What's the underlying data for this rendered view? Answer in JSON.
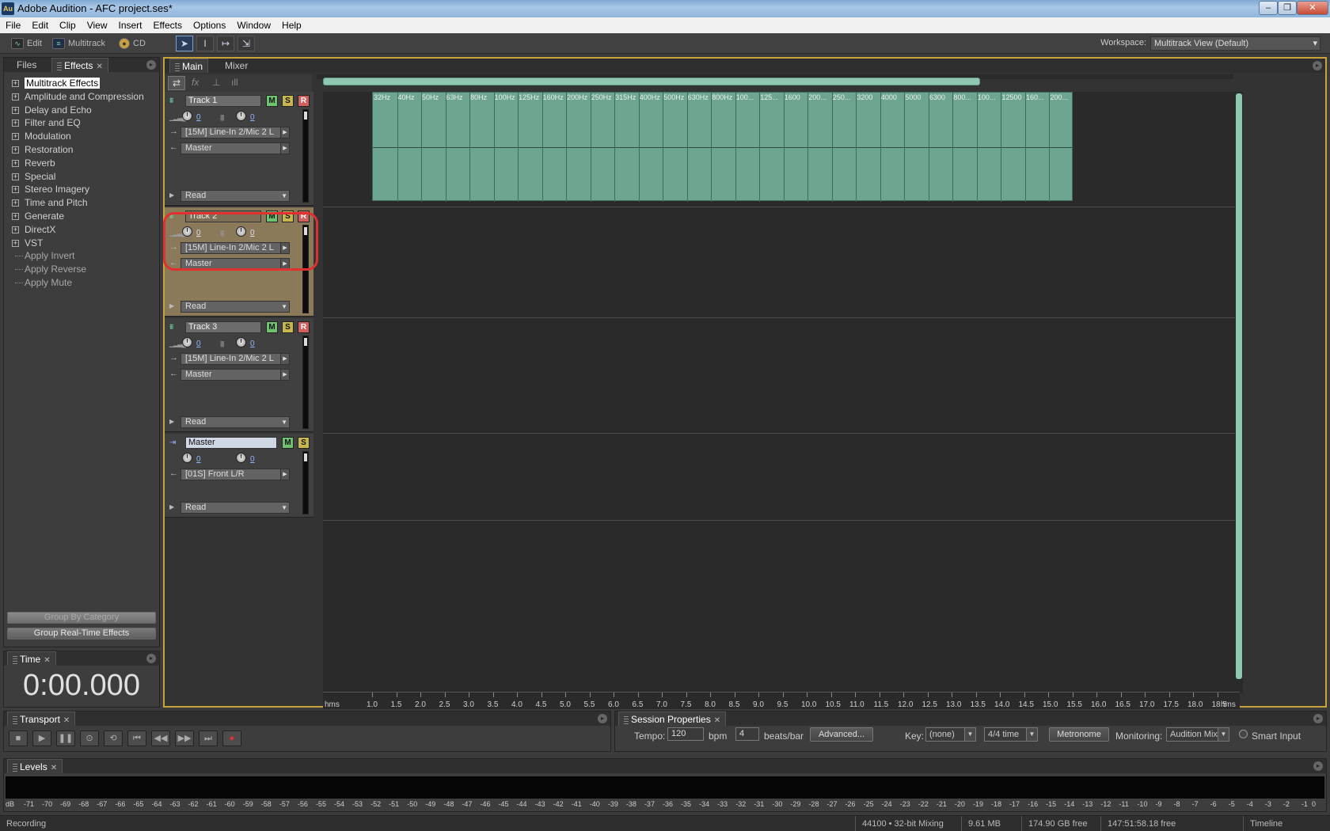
{
  "window": {
    "title": "Adobe Audition - AFC project.ses*",
    "app_icon": "Au"
  },
  "menu": [
    "File",
    "Edit",
    "Clip",
    "View",
    "Insert",
    "Effects",
    "Options",
    "Window",
    "Help"
  ],
  "toolbar": {
    "edit": "Edit",
    "multitrack": "Multitrack",
    "cd": "CD",
    "workspace_label": "Workspace:",
    "workspace_value": "Multitrack View (Default)"
  },
  "left_panel": {
    "tabs": [
      "Files",
      "Effects"
    ],
    "tree": [
      {
        "label": "Multitrack Effects",
        "expand": "+",
        "selected": true
      },
      {
        "label": "Amplitude and Compression",
        "expand": "+"
      },
      {
        "label": "Delay and Echo",
        "expand": "+"
      },
      {
        "label": "Filter and EQ",
        "expand": "+"
      },
      {
        "label": "Modulation",
        "expand": "+"
      },
      {
        "label": "Restoration",
        "expand": "+"
      },
      {
        "label": "Reverb",
        "expand": "+"
      },
      {
        "label": "Special",
        "expand": "+"
      },
      {
        "label": "Stereo Imagery",
        "expand": "+"
      },
      {
        "label": "Time and Pitch",
        "expand": "+"
      },
      {
        "label": "Generate",
        "expand": "+"
      },
      {
        "label": "DirectX",
        "expand": "+"
      },
      {
        "label": "VST",
        "expand": "+"
      },
      {
        "label": "Apply Invert",
        "leaf": true
      },
      {
        "label": "Apply Reverse",
        "leaf": true
      },
      {
        "label": "Apply Mute",
        "leaf": true
      }
    ],
    "group_by_category": "Group By Category",
    "group_realtime": "Group Real-Time Effects"
  },
  "time_panel": {
    "tab": "Time",
    "value": "0:00.000"
  },
  "main_tabs": [
    "Main",
    "Mixer"
  ],
  "tracks": [
    {
      "name": "Track 1",
      "m": "M",
      "s": "S",
      "r": "R",
      "vol": "0",
      "pan": "0",
      "input": "[15M] Line-In 2/Mic 2 L",
      "output": "Master",
      "automation": "Read",
      "selected": false
    },
    {
      "name": "Track 2",
      "m": "M",
      "s": "S",
      "r": "R",
      "vol": "0",
      "pan": "0",
      "input": "[15M] Line-In 2/Mic 2 L",
      "output": "Master",
      "automation": "Read",
      "selected": true
    },
    {
      "name": "Track 3",
      "m": "M",
      "s": "S",
      "r": "R",
      "vol": "0",
      "pan": "0",
      "input": "[15M] Line-In 2/Mic 2 L",
      "output": "Master",
      "automation": "Read",
      "selected": false
    }
  ],
  "master": {
    "name": "Master",
    "m": "M",
    "s": "S",
    "vol": "0",
    "pan": "0",
    "output": "[01S] Front L/R",
    "automation": "Read"
  },
  "clip_labels": [
    "32Hz",
    "40Hz",
    "50Hz",
    "63Hz",
    "80Hz",
    "100Hz",
    "125Hz",
    "160Hz",
    "200Hz",
    "250Hz",
    "315Hz",
    "400Hz",
    "500Hz",
    "630Hz",
    "800Hz",
    "100...",
    "125...",
    "1600",
    "200...",
    "250...",
    "3200",
    "4000",
    "5000",
    "6300",
    "800...",
    "100...",
    "12500",
    "160...",
    "200..."
  ],
  "ruler": {
    "unit": "hms",
    "ticks": [
      "1.0",
      "1.5",
      "2.0",
      "2.5",
      "3.0",
      "3.5",
      "4.0",
      "4.5",
      "5.0",
      "5.5",
      "6.0",
      "6.5",
      "7.0",
      "7.5",
      "8.0",
      "8.5",
      "9.0",
      "9.5",
      "10.0",
      "10.5",
      "11.0",
      "11.5",
      "12.0",
      "12.5",
      "13.0",
      "13.5",
      "14.0",
      "14.5",
      "15.0",
      "15.5",
      "16.0",
      "16.5",
      "17.0",
      "17.5",
      "18.0",
      "18.5"
    ]
  },
  "transport": {
    "tab": "Transport"
  },
  "session": {
    "tab": "Session Properties",
    "tempo_label": "Tempo:",
    "tempo": "120",
    "bpm": "bpm",
    "beats": "4",
    "beats_label": "beats/bar",
    "advanced": "Advanced...",
    "key_label": "Key:",
    "key": "(none)",
    "time_sig": "4/4 time",
    "metronome": "Metronome",
    "monitoring_label": "Monitoring:",
    "monitoring": "Audition Mix",
    "smart_input": "Smart Input"
  },
  "levels": {
    "tab": "Levels",
    "ticks": [
      "dB",
      "-71",
      "-70",
      "-69",
      "-68",
      "-67",
      "-66",
      "-65",
      "-64",
      "-63",
      "-62",
      "-61",
      "-60",
      "-59",
      "-58",
      "-57",
      "-56",
      "-55",
      "-54",
      "-53",
      "-52",
      "-51",
      "-50",
      "-49",
      "-48",
      "-47",
      "-46",
      "-45",
      "-44",
      "-43",
      "-42",
      "-41",
      "-40",
      "-39",
      "-38",
      "-37",
      "-36",
      "-35",
      "-34",
      "-33",
      "-32",
      "-31",
      "-30",
      "-29",
      "-28",
      "-27",
      "-26",
      "-25",
      "-24",
      "-23",
      "-22",
      "-21",
      "-20",
      "-19",
      "-18",
      "-17",
      "-16",
      "-15",
      "-14",
      "-13",
      "-12",
      "-11",
      "-10",
      "-9",
      "-8",
      "-7",
      "-6",
      "-5",
      "-4",
      "-3",
      "-2",
      "-1",
      "0"
    ]
  },
  "status": {
    "left": "Recording",
    "rate": "44100 • 32-bit Mixing",
    "mem": "9.61 MB",
    "disk": "174.90 GB free",
    "time_free": "147:51:58.18 free",
    "view": "Timeline"
  },
  "colors": {
    "clip": "#6ea590",
    "selected_track": "#8a7a5a",
    "highlight": "#e03030",
    "frame": "#c9a23a"
  }
}
